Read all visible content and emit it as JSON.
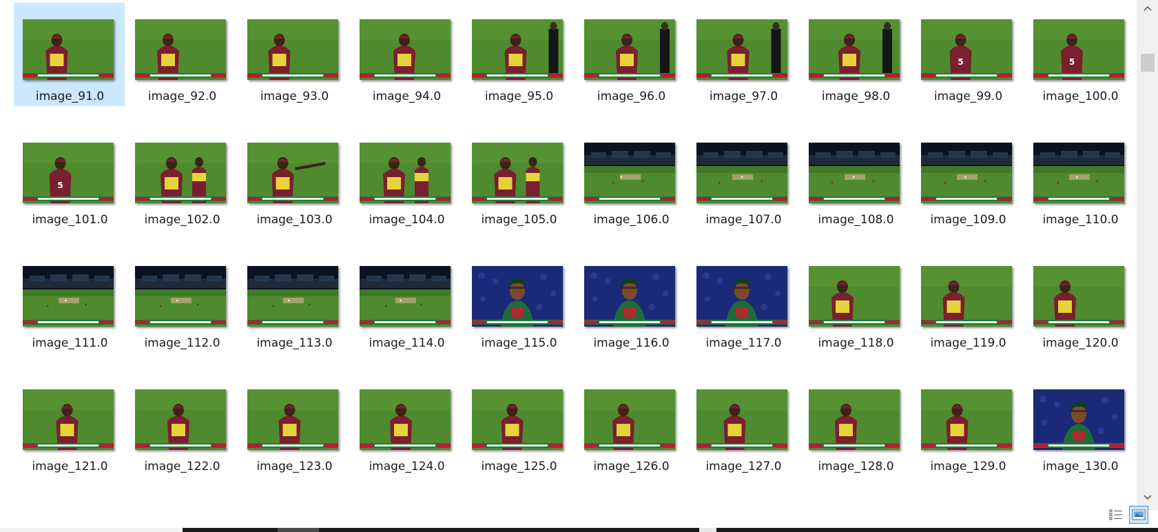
{
  "selected_item": "image_91.0",
  "files": [
    {
      "name": "image_91.0",
      "scene": "player"
    },
    {
      "name": "image_92.0",
      "scene": "player"
    },
    {
      "name": "image_93.0",
      "scene": "player"
    },
    {
      "name": "image_94.0",
      "scene": "player"
    },
    {
      "name": "image_95.0",
      "scene": "player-umpire"
    },
    {
      "name": "image_96.0",
      "scene": "player-umpire"
    },
    {
      "name": "image_97.0",
      "scene": "player-umpire"
    },
    {
      "name": "image_98.0",
      "scene": "player-umpire"
    },
    {
      "name": "image_99.0",
      "scene": "player-back"
    },
    {
      "name": "image_100.0",
      "scene": "player-back"
    },
    {
      "name": "image_101.0",
      "scene": "player-back"
    },
    {
      "name": "image_102.0",
      "scene": "two-players"
    },
    {
      "name": "image_103.0",
      "scene": "player-point"
    },
    {
      "name": "image_104.0",
      "scene": "two-players"
    },
    {
      "name": "image_105.0",
      "scene": "two-players"
    },
    {
      "name": "image_106.0",
      "scene": "stadium"
    },
    {
      "name": "image_107.0",
      "scene": "stadium"
    },
    {
      "name": "image_108.0",
      "scene": "stadium"
    },
    {
      "name": "image_109.0",
      "scene": "stadium"
    },
    {
      "name": "image_110.0",
      "scene": "stadium"
    },
    {
      "name": "image_111.0",
      "scene": "stadium"
    },
    {
      "name": "image_112.0",
      "scene": "stadium"
    },
    {
      "name": "image_113.0",
      "scene": "stadium"
    },
    {
      "name": "image_114.0",
      "scene": "stadium"
    },
    {
      "name": "image_115.0",
      "scene": "batsman"
    },
    {
      "name": "image_116.0",
      "scene": "batsman"
    },
    {
      "name": "image_117.0",
      "scene": "batsman"
    },
    {
      "name": "image_118.0",
      "scene": "player"
    },
    {
      "name": "image_119.0",
      "scene": "player"
    },
    {
      "name": "image_120.0",
      "scene": "player"
    },
    {
      "name": "image_121.0",
      "scene": "player"
    },
    {
      "name": "image_122.0",
      "scene": "player"
    },
    {
      "name": "image_123.0",
      "scene": "player"
    },
    {
      "name": "image_124.0",
      "scene": "player"
    },
    {
      "name": "image_125.0",
      "scene": "player"
    },
    {
      "name": "image_126.0",
      "scene": "player"
    },
    {
      "name": "image_127.0",
      "scene": "player"
    },
    {
      "name": "image_128.0",
      "scene": "player"
    },
    {
      "name": "image_129.0",
      "scene": "player"
    },
    {
      "name": "image_130.0",
      "scene": "batsman"
    }
  ],
  "icons": {
    "scroll_up": "chevron-up-icon",
    "scroll_down": "chevron-down-icon",
    "details_view": "details-view-icon",
    "large_icons_view": "large-icons-view-icon"
  },
  "colors": {
    "selection": "#cce8ff",
    "selection_border": "#3c8ed6",
    "grass": "#4f8a2e",
    "maroon_jersey": "#7a1f2e",
    "yellow_jersey": "#e6d23a",
    "batsman_bg": "#1b2a78",
    "batsman_jersey": "#1f6b3a",
    "scoreboard_red": "#b02030"
  }
}
